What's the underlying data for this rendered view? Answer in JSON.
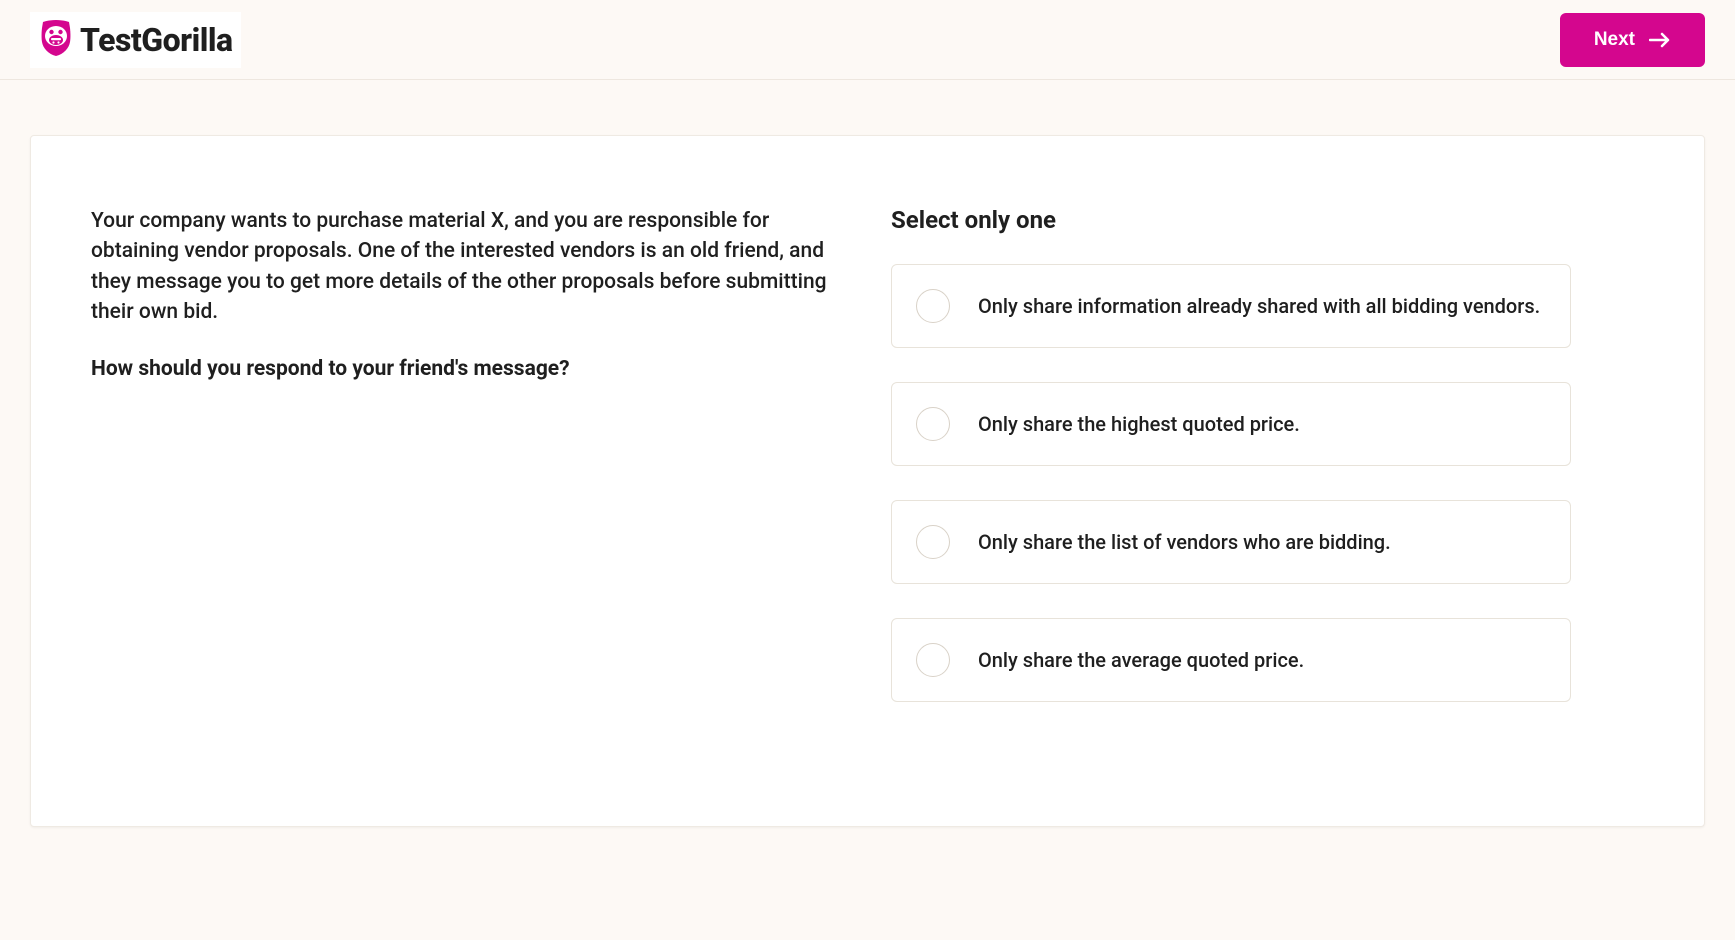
{
  "header": {
    "brand_name": "TestGorilla",
    "next_label": "Next"
  },
  "question": {
    "scenario": "Your company wants to purchase material X, and you are responsible for obtaining vendor proposals. One of the interested vendors is an old friend, and they message you to get more details of the other proposals before submitting their own bid.",
    "prompt": "How should you respond to your friend's message?"
  },
  "answers": {
    "instruction": "Select only one",
    "options": [
      {
        "label": "Only share information already shared with all bidding vendors."
      },
      {
        "label": "Only share the highest quoted price."
      },
      {
        "label": "Only share the list of vendors who are bidding."
      },
      {
        "label": "Only share the average quoted price."
      }
    ]
  },
  "colors": {
    "accent": "#d4068e",
    "bg": "#fdf9f5"
  }
}
